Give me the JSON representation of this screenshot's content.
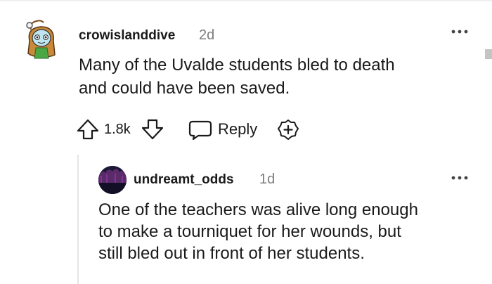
{
  "comments": [
    {
      "username": "crowislanddive",
      "time": "2d",
      "body_lines": [
        "Many of the Uvalde students bled to death",
        "and could have been saved."
      ],
      "votes": "1.8k",
      "reply_label": "Reply"
    },
    {
      "username": "undreamt_odds",
      "time": "1d",
      "body_lines": [
        "One of the teachers was alive long enough",
        "to make a tourniquet for her wounds, but",
        "still bled out in front of her students."
      ]
    }
  ],
  "icons": {
    "upvote": "arrow-up-icon",
    "downvote": "arrow-down-icon",
    "reply": "speech-bubble-icon",
    "award": "award-plus-icon",
    "more": "more-options-icon"
  },
  "colors": {
    "text": "#1a1a1b",
    "meta": "#7c7c7c",
    "thread_line": "#e5e5e5"
  }
}
